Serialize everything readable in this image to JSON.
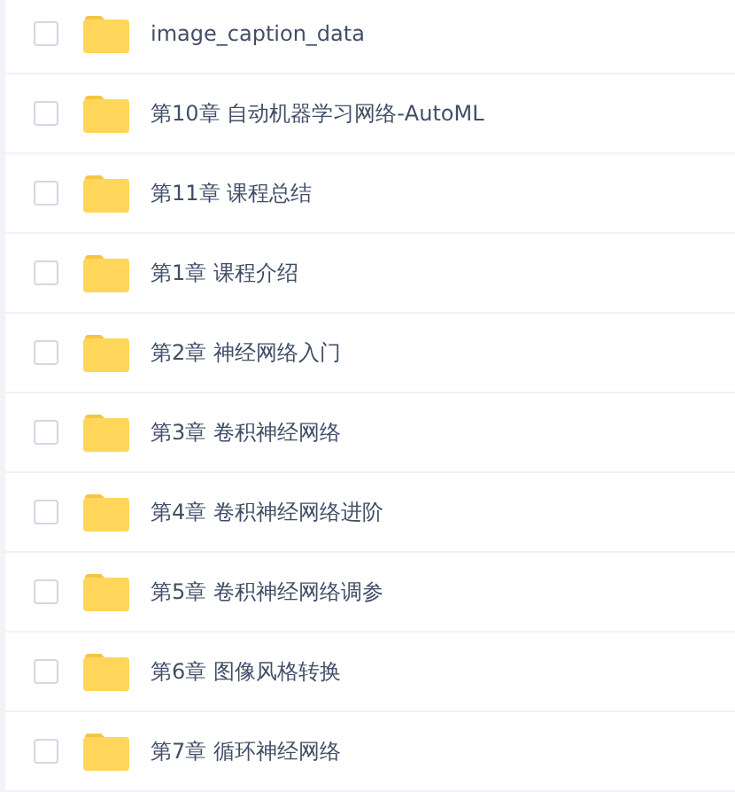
{
  "files": [
    {
      "name": "image_caption_data",
      "checked": false
    },
    {
      "name": "第10章 自动机器学习网络-AutoML",
      "checked": false
    },
    {
      "name": "第11章 课程总结",
      "checked": false
    },
    {
      "name": "第1章 课程介绍",
      "checked": false
    },
    {
      "name": "第2章 神经网络入门",
      "checked": false
    },
    {
      "name": "第3章 卷积神经网络",
      "checked": false
    },
    {
      "name": "第4章 卷积神经网络进阶",
      "checked": false
    },
    {
      "name": "第5章 卷积神经网络调参",
      "checked": false
    },
    {
      "name": "第6章 图像风格转换",
      "checked": false
    },
    {
      "name": "第7章 循环神经网络",
      "checked": false
    }
  ]
}
